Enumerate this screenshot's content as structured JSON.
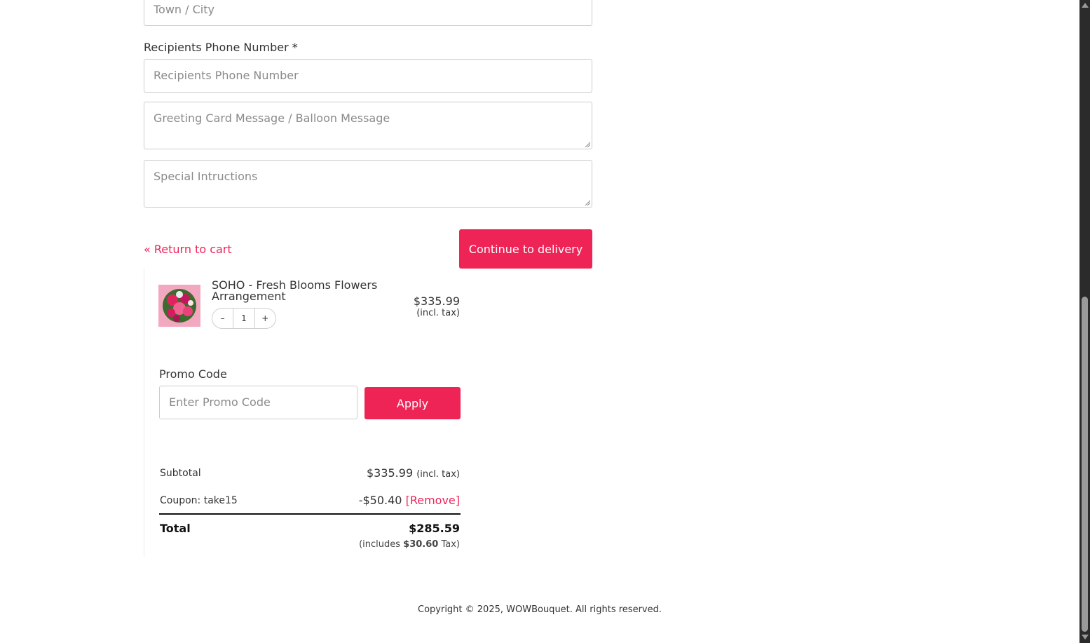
{
  "address": {
    "town_placeholder": "Town / City"
  },
  "phone": {
    "label": "Recipients Phone Number *",
    "placeholder": "Recipients Phone Number"
  },
  "messages": {
    "greeting_placeholder": "Greeting Card Message / Balloon Message",
    "instructions_placeholder": "Special Intructions"
  },
  "actions": {
    "return_label": "« Return to cart",
    "continue_label": "Continue to delivery"
  },
  "item": {
    "name": "SOHO - Fresh Blooms Flowers Arrangement",
    "quantity": "1",
    "minus": "–",
    "plus": "+",
    "price": "$335.99",
    "price_note": "(incl. tax)"
  },
  "promo": {
    "label": "Promo Code",
    "placeholder": "Enter Promo Code",
    "apply_label": "Apply"
  },
  "totals": {
    "subtotal_label": "Subtotal",
    "subtotal_value": "$335.99",
    "subtotal_note": "(incl. tax)",
    "coupon_label": "Coupon: take15",
    "coupon_value": "-$50.40",
    "coupon_remove": "[Remove]",
    "total_label": "Total",
    "total_value": "$285.59",
    "tax_prefix": "(includes",
    "tax_value": "$30.60",
    "tax_suffix": "Tax)"
  },
  "footer": {
    "copyright": "Copyright © 2025, WOWBouquet. All rights reserved."
  },
  "colors": {
    "accent": "#ee2356",
    "border": "#cccccc",
    "text": "#333333"
  }
}
